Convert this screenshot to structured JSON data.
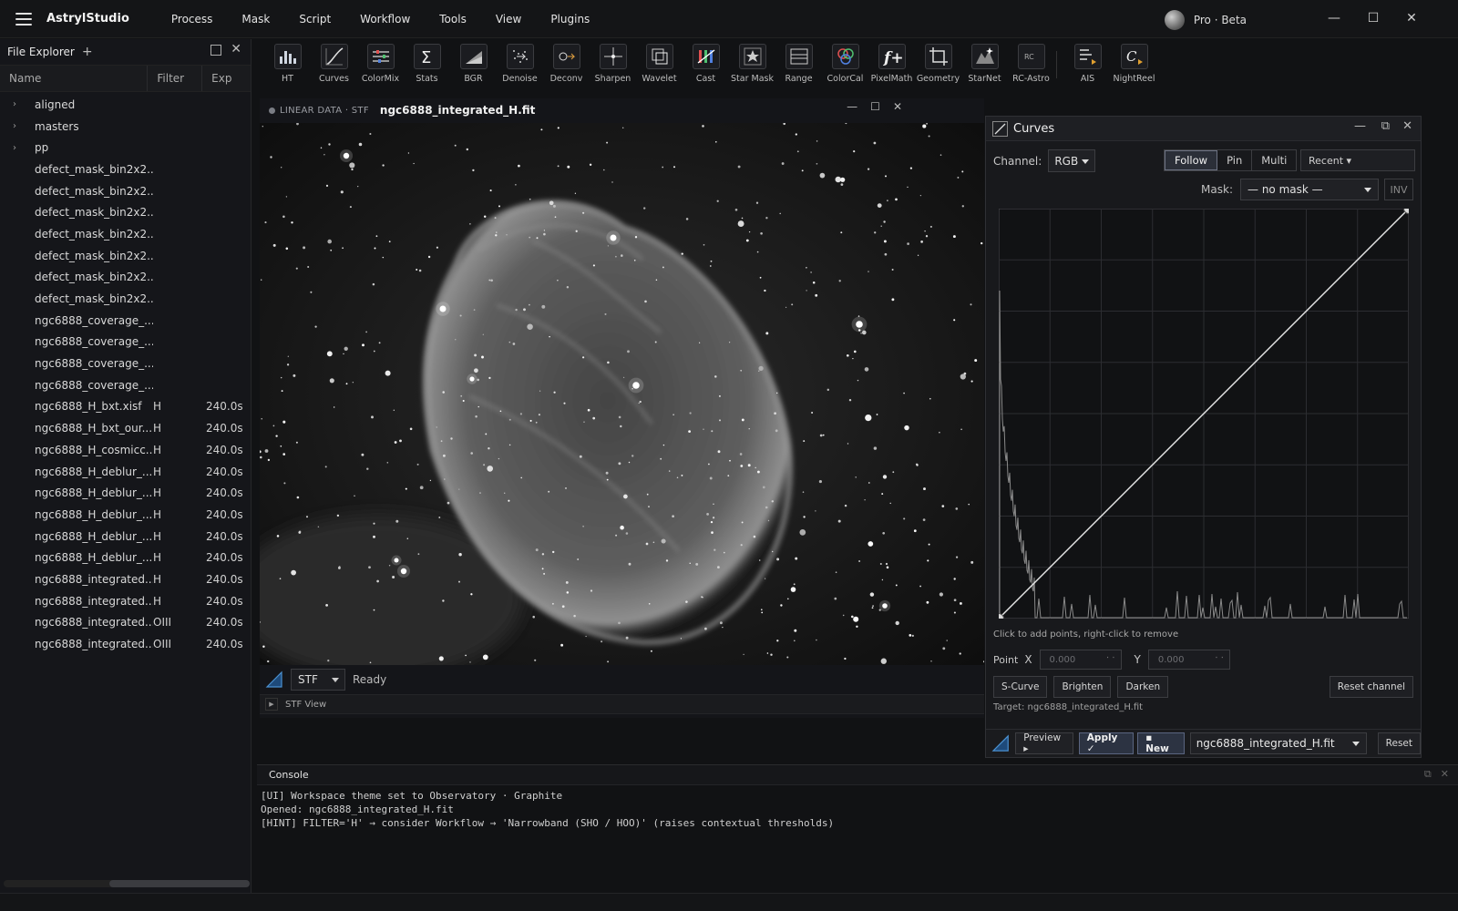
{
  "app": {
    "name": "AstrylStudio",
    "profile": "Pro · Beta",
    "menu": [
      "Process",
      "Mask",
      "Script",
      "Workflow",
      "Tools",
      "View",
      "Plugins"
    ]
  },
  "explorer": {
    "title": "File Explorer",
    "add": "+",
    "columns": {
      "name": "Name",
      "filter": "Filter",
      "exp": "Exp"
    },
    "rows": [
      {
        "name": "aligned",
        "folder": true,
        "filter": "",
        "exp": ""
      },
      {
        "name": "masters",
        "folder": true,
        "filter": "",
        "exp": ""
      },
      {
        "name": "pp",
        "folder": true,
        "filter": "",
        "exp": ""
      },
      {
        "name": "defect_mask_bin2x2...",
        "folder": false,
        "filter": "",
        "exp": ""
      },
      {
        "name": "defect_mask_bin2x2...",
        "folder": false,
        "filter": "",
        "exp": ""
      },
      {
        "name": "defect_mask_bin2x2...",
        "folder": false,
        "filter": "",
        "exp": ""
      },
      {
        "name": "defect_mask_bin2x2...",
        "folder": false,
        "filter": "",
        "exp": ""
      },
      {
        "name": "defect_mask_bin2x2...",
        "folder": false,
        "filter": "",
        "exp": ""
      },
      {
        "name": "defect_mask_bin2x2...",
        "folder": false,
        "filter": "",
        "exp": ""
      },
      {
        "name": "defect_mask_bin2x2...",
        "folder": false,
        "filter": "",
        "exp": ""
      },
      {
        "name": "ngc6888_coverage_...",
        "folder": false,
        "filter": "",
        "exp": ""
      },
      {
        "name": "ngc6888_coverage_...",
        "folder": false,
        "filter": "",
        "exp": ""
      },
      {
        "name": "ngc6888_coverage_...",
        "folder": false,
        "filter": "",
        "exp": ""
      },
      {
        "name": "ngc6888_coverage_...",
        "folder": false,
        "filter": "",
        "exp": ""
      },
      {
        "name": "ngc6888_H_bxt.xisf",
        "folder": false,
        "filter": "H",
        "exp": "240.0s"
      },
      {
        "name": "ngc6888_H_bxt_our...",
        "folder": false,
        "filter": "H",
        "exp": "240.0s"
      },
      {
        "name": "ngc6888_H_cosmicc...",
        "folder": false,
        "filter": "H",
        "exp": "240.0s"
      },
      {
        "name": "ngc6888_H_deblur_...",
        "folder": false,
        "filter": "H",
        "exp": "240.0s"
      },
      {
        "name": "ngc6888_H_deblur_...",
        "folder": false,
        "filter": "H",
        "exp": "240.0s"
      },
      {
        "name": "ngc6888_H_deblur_...",
        "folder": false,
        "filter": "H",
        "exp": "240.0s"
      },
      {
        "name": "ngc6888_H_deblur_...",
        "folder": false,
        "filter": "H",
        "exp": "240.0s"
      },
      {
        "name": "ngc6888_H_deblur_...",
        "folder": false,
        "filter": "H",
        "exp": "240.0s"
      },
      {
        "name": "ngc6888_integrated...",
        "folder": false,
        "filter": "H",
        "exp": "240.0s"
      },
      {
        "name": "ngc6888_integrated...",
        "folder": false,
        "filter": "H",
        "exp": "240.0s"
      },
      {
        "name": "ngc6888_integrated...",
        "folder": false,
        "filter": "OIII",
        "exp": "240.0s"
      },
      {
        "name": "ngc6888_integrated...",
        "folder": false,
        "filter": "OIII",
        "exp": "240.0s"
      }
    ]
  },
  "toolbar": {
    "tools": [
      {
        "label": "HT",
        "icon": "histogram-icon"
      },
      {
        "label": "Curves",
        "icon": "curves-icon"
      },
      {
        "label": "ColorMix",
        "icon": "sliders-icon"
      },
      {
        "label": "Stats",
        "icon": "sigma-icon"
      },
      {
        "label": "BGR",
        "icon": "gradient-icon"
      },
      {
        "label": "Denoise",
        "icon": "denoise-icon"
      },
      {
        "label": "Deconv",
        "icon": "deconv-icon"
      },
      {
        "label": "Sharpen",
        "icon": "crosshair-icon"
      },
      {
        "label": "Wavelet",
        "icon": "layers-icon"
      },
      {
        "label": "Cast",
        "icon": "color-bars-icon"
      },
      {
        "label": "Star Mask",
        "icon": "star-icon"
      },
      {
        "label": "Range",
        "icon": "range-icon"
      },
      {
        "label": "ColorCal",
        "icon": "rgb-circles-icon"
      },
      {
        "label": "PixelMath",
        "icon": "function-icon"
      },
      {
        "label": "Geometry",
        "icon": "crop-icon"
      },
      {
        "label": "StarNet",
        "icon": "starnet-icon"
      },
      {
        "label": "RC-Astro",
        "icon": "rc-astro-icon",
        "text": "RC"
      }
    ],
    "extra_tools": [
      {
        "label": "AIS",
        "icon": "ais-icon"
      },
      {
        "label": "NightReel",
        "icon": "nightreel-icon"
      }
    ]
  },
  "image_window": {
    "mode_tag": "LINEAR DATA · STF",
    "title": "ngc6888_integrated_H.fit",
    "stf_select": "STF",
    "status": "Ready",
    "stf_view_label": "STF View"
  },
  "curves": {
    "title": "Curves",
    "channel_label": "Channel:",
    "channel": "RGB",
    "modes": [
      "Follow",
      "Pin",
      "Multi"
    ],
    "active_mode": "Follow",
    "recent": "Recent ▾",
    "mask_label": "Mask:",
    "mask": "— no mask —",
    "inv": "INV",
    "hint": "Click to add points, right-click to remove",
    "point_label": "Point",
    "x_label": "X",
    "y_label": "Y",
    "x_value": "0.000",
    "y_value": "0.000",
    "presets": [
      "S-Curve",
      "Brighten",
      "Darken"
    ],
    "reset_channel": "Reset channel",
    "target": "Target: ngc6888_integrated_H.fit",
    "preview": "Preview ▸",
    "apply": "Apply ✓",
    "new": "▪ New",
    "target_select": "ngc6888_integrated_H.fit",
    "reset": "Reset",
    "curve_points": [
      [
        0,
        0
      ],
      [
        1,
        1
      ]
    ]
  },
  "console": {
    "title": "Console",
    "lines": [
      "[UI] Workspace theme set to Observatory · Graphite",
      "Opened: ngc6888_integrated_H.fit",
      "[HINT] FILTER='H' → consider Workflow → 'Narrowband (SHO / HOO)' (raises contextual thresholds)"
    ]
  }
}
